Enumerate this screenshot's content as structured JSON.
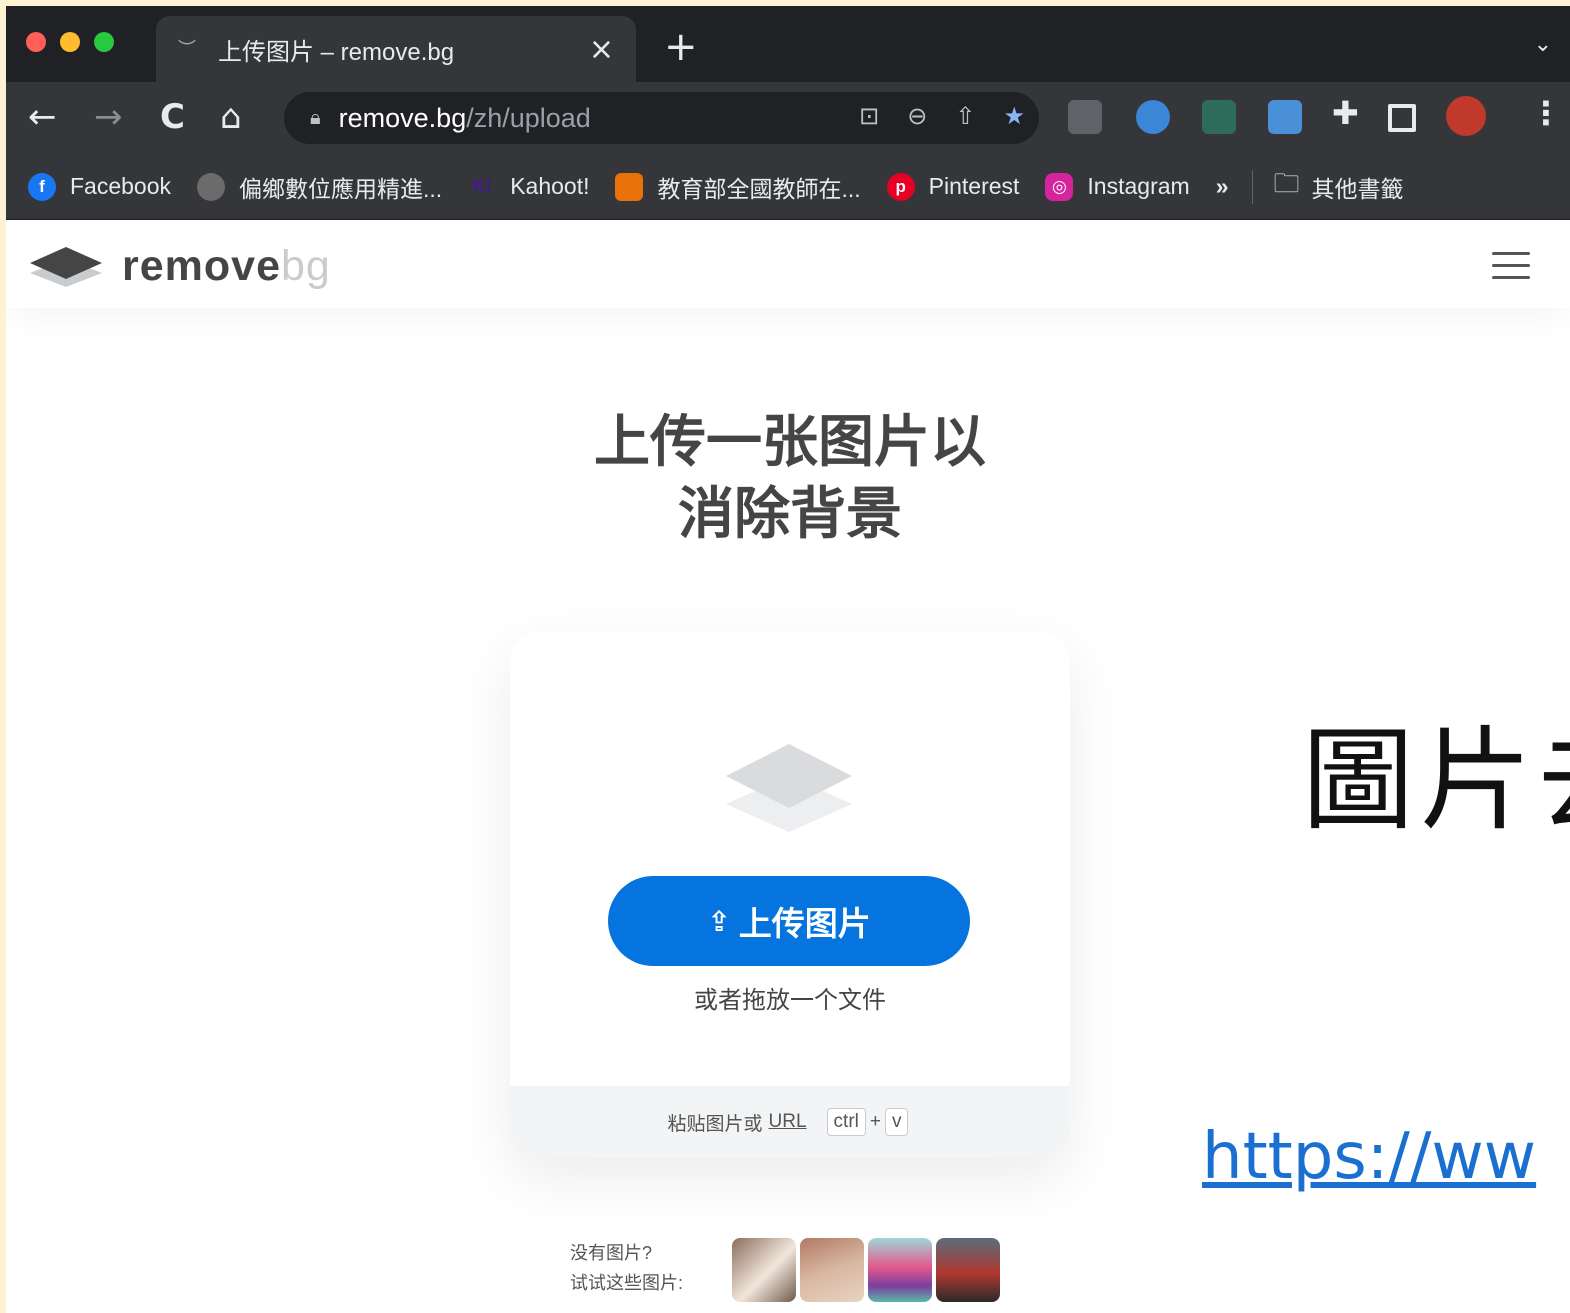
{
  "browser": {
    "tab_title": "上传图片 – remove.bg",
    "tab_close": "×",
    "new_tab": "+",
    "tab_menu": "⌄",
    "address_host": "remove.bg",
    "address_path": "/zh/upload",
    "nav": {
      "back": "←",
      "forward": "→",
      "reload": "C",
      "home": "⌂"
    },
    "bookmarks": [
      {
        "label": "Facebook",
        "icon": "facebook-icon",
        "color": "#1877f2",
        "glyph": "f"
      },
      {
        "label": "偏鄉數位應用精進...",
        "icon": "robot-icon",
        "color": "#6b6b6b",
        "glyph": ""
      },
      {
        "label": "Kahoot!",
        "icon": "kahoot-icon",
        "color": "#46178f",
        "glyph": "K!"
      },
      {
        "label": "教育部全國教師在...",
        "icon": "moe-icon",
        "color": "#e8710a",
        "glyph": ""
      },
      {
        "label": "Pinterest",
        "icon": "pinterest-icon",
        "color": "#e60023",
        "glyph": "p"
      },
      {
        "label": "Instagram",
        "icon": "instagram-icon",
        "color": "#d6249f",
        "glyph": "◎"
      }
    ],
    "bookmarks_more": "»",
    "other_bookmarks": "其他書籤"
  },
  "site": {
    "logo_word": "remove",
    "logo_suffix": "bg",
    "headline_line1": "上传一张图片以",
    "headline_line2": "消除背景",
    "upload_button": "上传图片",
    "drop_text": "或者拖放一个文件",
    "paste_text": "粘贴图片或",
    "paste_url": "URL",
    "key_ctrl": "ctrl",
    "key_plus": "+",
    "key_v": "v",
    "no_image_line1": "没有图片?",
    "no_image_line2": "试试这些图片:",
    "accent_color": "#0574de"
  },
  "overlay": {
    "title": "圖片去",
    "link": "https://ww"
  }
}
